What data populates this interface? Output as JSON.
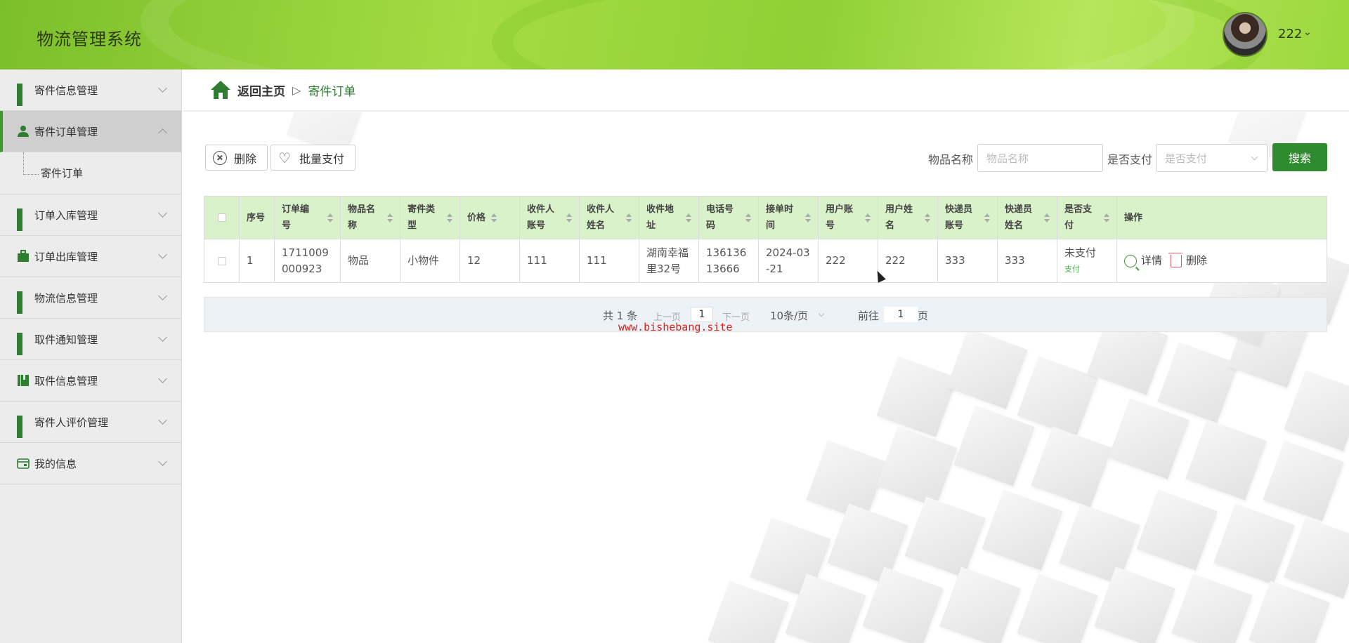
{
  "app": {
    "title": "物流管理系统"
  },
  "user": {
    "name": "222",
    "caret": "⌄"
  },
  "sidebar": {
    "items": [
      {
        "label": "寄件信息管理",
        "icon": "grid-icon",
        "active": false
      },
      {
        "label": "寄件订单管理",
        "icon": "person-icon",
        "active": true,
        "children": [
          {
            "label": "寄件订单"
          }
        ]
      },
      {
        "label": "订单入库管理",
        "icon": "grid-icon",
        "active": false
      },
      {
        "label": "订单出库管理",
        "icon": "briefcase-icon",
        "active": false
      },
      {
        "label": "物流信息管理",
        "icon": "grid-icon",
        "active": false
      },
      {
        "label": "取件通知管理",
        "icon": "grid-icon",
        "active": false
      },
      {
        "label": "取件信息管理",
        "icon": "book-icon",
        "active": false
      },
      {
        "label": "寄件人评价管理",
        "icon": "grid-icon",
        "active": false
      },
      {
        "label": "我的信息",
        "icon": "card-icon",
        "active": false
      }
    ]
  },
  "breadcrumb": {
    "home": "返回主页",
    "separator": "▷",
    "current": "寄件订单"
  },
  "toolbar": {
    "delete_label": "删除",
    "batch_pay_label": "批量支付",
    "item_name_label": "物品名称",
    "item_name_placeholder": "物品名称",
    "paid_label": "是否支付",
    "paid_placeholder": "是否支付",
    "search_label": "搜索"
  },
  "table": {
    "headers": [
      {
        "l1": "序号",
        "l2": ""
      },
      {
        "l1": "订单编",
        "l2": "号"
      },
      {
        "l1": "物品名",
        "l2": "称"
      },
      {
        "l1": "寄件类",
        "l2": "型"
      },
      {
        "l1": "价格",
        "l2": ""
      },
      {
        "l1": "收件人",
        "l2": "账号"
      },
      {
        "l1": "收件人",
        "l2": "姓名"
      },
      {
        "l1": "收件地",
        "l2": "址"
      },
      {
        "l1": "电话号",
        "l2": "码"
      },
      {
        "l1": "接单时",
        "l2": "间"
      },
      {
        "l1": "用户账",
        "l2": "号"
      },
      {
        "l1": "用户姓",
        "l2": "名"
      },
      {
        "l1": "快递员",
        "l2": "账号"
      },
      {
        "l1": "快递员",
        "l2": "姓名"
      },
      {
        "l1": "是否支",
        "l2": "付"
      },
      {
        "l1": "操作",
        "l2": ""
      }
    ],
    "rows": [
      {
        "index": "1",
        "order_no_1": "1711009",
        "order_no_2": "000923",
        "item_name": "物品",
        "item_type": "小物件",
        "price": "12",
        "receiver_account": "111",
        "receiver_name": "111",
        "address_1": "湖南幸福",
        "address_2": "里32号",
        "phone_1": "136136",
        "phone_2": "13666",
        "time_1": "2024-03",
        "time_2": "-21",
        "user_account": "222",
        "user_name": "222",
        "courier_account": "333",
        "courier_name": "333",
        "paid_status": "未支付",
        "pay_action": "支付",
        "detail_label": "详情",
        "delete_label": "删除"
      }
    ]
  },
  "pagination": {
    "total": "共 1 条",
    "prev": "上一页",
    "page": "1",
    "next": "下一页",
    "page_size": "10条/页",
    "goto_label": "前往",
    "goto_value": "1",
    "page_suffix": "页"
  },
  "watermark": "www.bishebang.site",
  "colors": {
    "accent": "#2e8b2e",
    "header_bg": "#a3dc43",
    "table_head": "#d9f2c9",
    "delete_red": "#e06060"
  }
}
